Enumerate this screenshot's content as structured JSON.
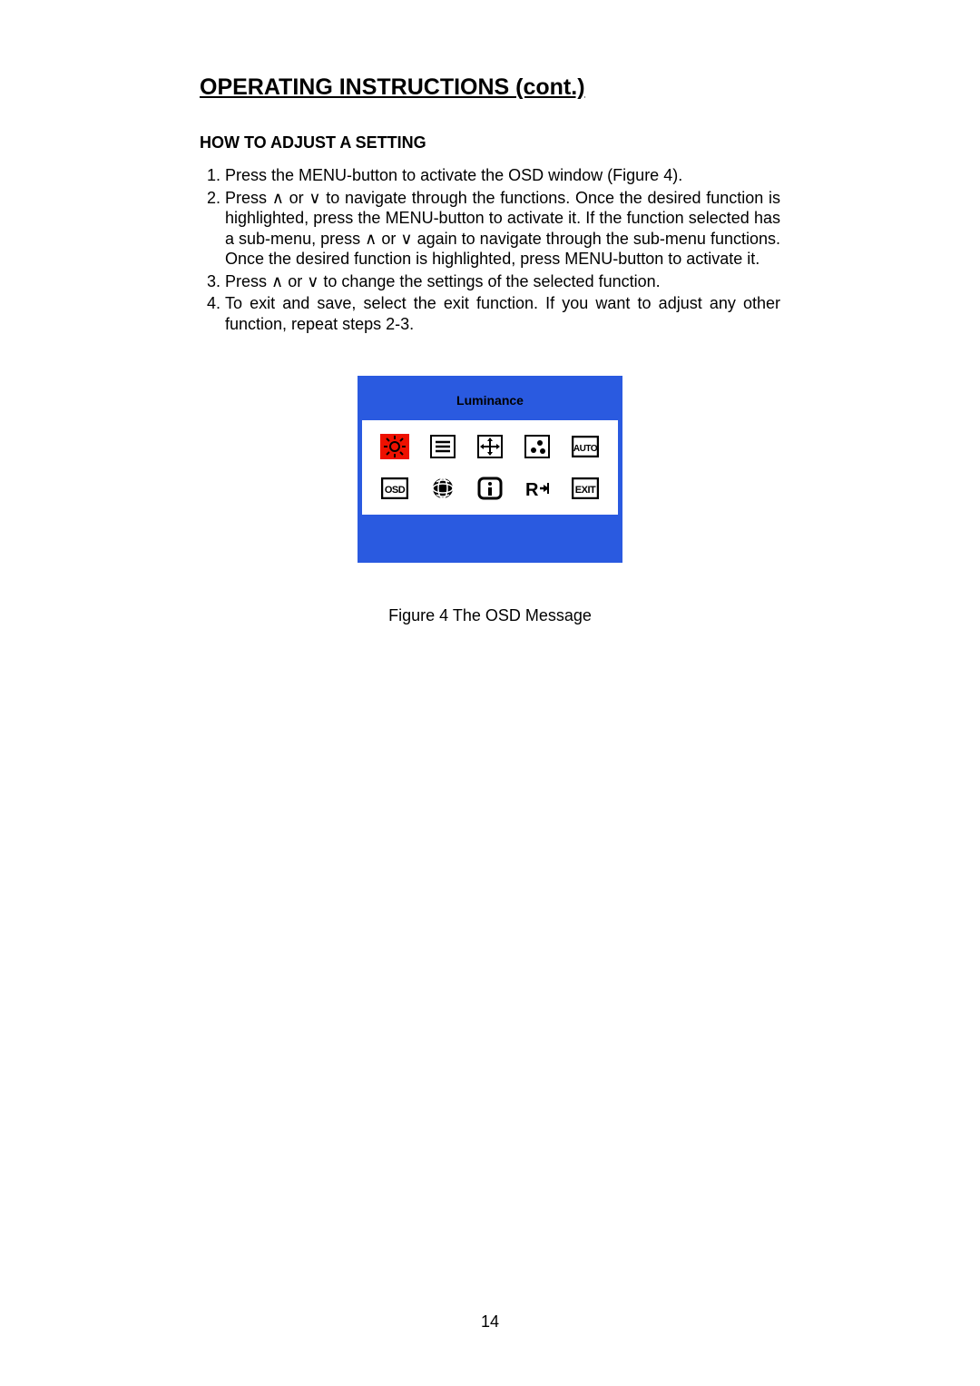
{
  "title": "OPERATING INSTRUCTIONS (cont.)",
  "subtitle": "HOW TO ADJUST A SETTING",
  "steps": {
    "s1": "Press the MENU-button to activate the OSD window (Figure 4).",
    "s2": "Press ∧ or ∨ to  navigate  through  the  functions.  Once  the  desired function is highlighted, press the MENU-button to activate it. If the function selected has a sub-menu, press  ∧ or ∨ again to navigate through  the  sub-menu  functions.  Once  the  desired  function  is highlighted, press MENU-button to activate it.",
    "s3": "Press  ∧ or  ∨ to change the settings of the selected function.",
    "s4": "To exit and save, select the exit function. If you want to adjust any other function, repeat steps 2-3."
  },
  "osd": {
    "header": "Luminance",
    "icons": {
      "luminance": "luminance-icon",
      "list": "list-icon",
      "position": "position-icon",
      "color": "color-icon",
      "auto": "AUTO",
      "osd_label": "OSD",
      "globe": "globe-icon",
      "info": "info-icon",
      "reset": "reset-icon",
      "exit": "EXIT"
    }
  },
  "figure_caption": "Figure 4   The  OSD  Message",
  "page_number": "14"
}
